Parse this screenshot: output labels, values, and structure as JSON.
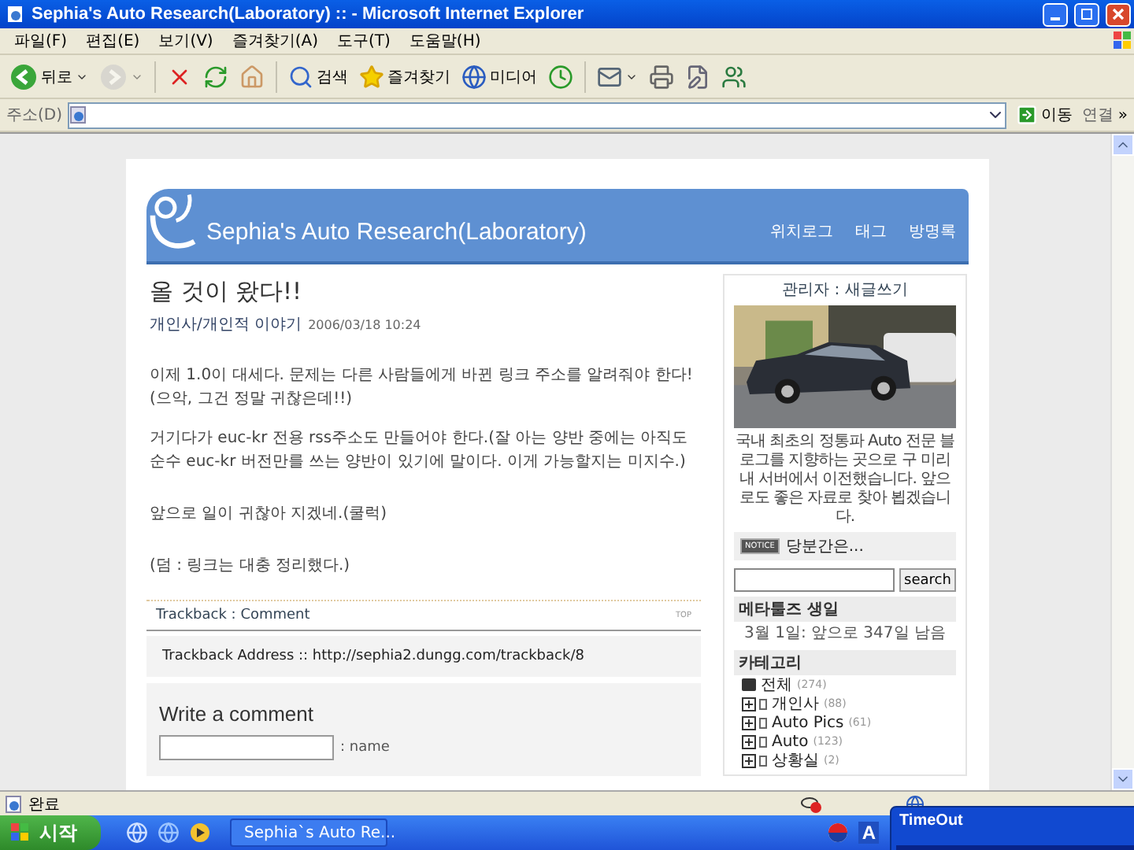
{
  "window": {
    "title": "Sephia's Auto Research(Laboratory) :: - Microsoft Internet Explorer"
  },
  "menu": [
    "파일(F)",
    "편집(E)",
    "보기(V)",
    "즐겨찾기(A)",
    "도구(T)",
    "도움말(H)"
  ],
  "toolbar": [
    {
      "kind": "back",
      "label": "뒤로",
      "disabled": false,
      "dropdown": true
    },
    {
      "kind": "forward",
      "disabled": true,
      "dropdown": true
    },
    {
      "kind": "stop",
      "disabled": false,
      "dropdown": false
    },
    {
      "kind": "refresh",
      "disabled": false,
      "dropdown": false
    },
    {
      "kind": "home",
      "disabled": false,
      "dropdown": false
    },
    {
      "kind": "search",
      "label": "검색",
      "disabled": false,
      "dropdown": false
    },
    {
      "kind": "favorites",
      "label": "즐겨찾기",
      "disabled": false,
      "dropdown": false
    },
    {
      "kind": "media",
      "label": "미디어",
      "disabled": false,
      "dropdown": false
    },
    {
      "kind": "history",
      "disabled": false,
      "dropdown": false
    },
    {
      "kind": "mail",
      "disabled": false,
      "dropdown": true
    },
    {
      "kind": "print",
      "disabled": false,
      "dropdown": false
    },
    {
      "kind": "edit",
      "disabled": false,
      "dropdown": false
    },
    {
      "kind": "messenger",
      "disabled": false,
      "dropdown": false
    }
  ],
  "address_bar": {
    "label": "주소(D)",
    "go": "이동",
    "links": "연결",
    "more": "»"
  },
  "blog": {
    "title": "Sephia's Auto Research(Laboratory)",
    "nav": [
      "위치로그",
      "태그",
      "방명록"
    ],
    "post": {
      "title": "올 것이 왔다!!",
      "category": "개인사/개인적 이야기",
      "date": "2006/03/18 10:24",
      "paragraphs": [
        "이제 1.0이 대세다. 문제는 다른 사람들에게 바뀐 링크 주소를 알려줘야 한다!(으악, 그건 정말 귀찮은데!!)",
        "거기다가 euc-kr 전용 rss주소도 만들어야 한다.(잘 아는 양반 중에는 아직도 순수 euc-kr 버전만를 쓰는 양반이 있기에 말이다. 이게 가능할지는 미지수.)",
        "앞으로 일이 귀찮아 지겠네.(쿨럭)",
        "(덤 : 링크는 대충 정리했다.)"
      ],
      "trackback_link": "Trackback : Comment",
      "top": "TOP",
      "trackback_address": "Trackback Address :: http://sephia2.dungg.com/trackback/8",
      "comment_heading": "Write a comment",
      "name_label": ": name"
    },
    "sidebar": {
      "admin": "관리자 : 새글쓰기",
      "description": "국내 최초의 정통파 Auto 전문 블로그를 지향하는 곳으로 구 미리내 서버에서 이전했습니다. 앞으로도 좋은 자료로 찾아 뵙겠습니다.",
      "notice_badge": "NOTICE",
      "notice": "당분간은...",
      "search_button": "search",
      "birthday_heading": "메타툴즈 생일",
      "birthday": "3월 1일: 앞으로 347일 남음",
      "category_heading": "카테고리",
      "categories": [
        {
          "label": "전체",
          "count": "(274)",
          "expanded": true,
          "children": [
            {
              "label": "개인사",
              "count": "(88)",
              "expanded": false
            },
            {
              "label": "Auto Pics",
              "count": "(61)",
              "expanded": false
            },
            {
              "label": "Auto",
              "count": "(123)",
              "expanded": false
            },
            {
              "label": "상황실",
              "count": "(2)",
              "expanded": false
            }
          ]
        }
      ]
    }
  },
  "status_bar": {
    "text": "완료"
  },
  "taskbar": {
    "start": "시작",
    "task": "Sephia`s Auto Re...",
    "tray_letter": "A"
  },
  "popup": {
    "title": "TimeOut"
  }
}
